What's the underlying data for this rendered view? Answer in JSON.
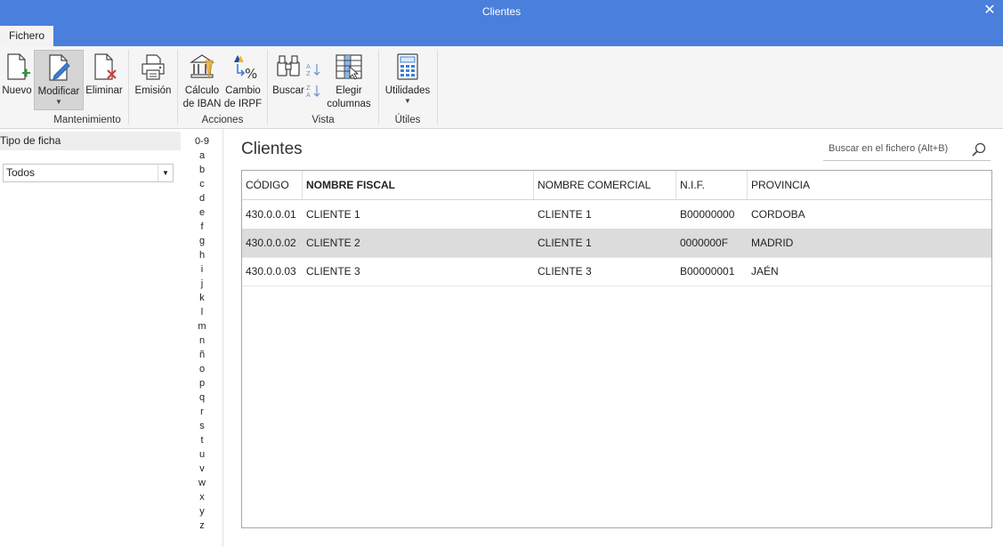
{
  "window": {
    "title": "Clientes",
    "close_label": "✕"
  },
  "tabs": [
    {
      "label": "Fichero"
    }
  ],
  "ribbon": {
    "buttons": [
      {
        "label1": "Nuevo",
        "label2": ""
      },
      {
        "label1": "Modificar",
        "label2": ""
      },
      {
        "label1": "Eliminar",
        "label2": ""
      },
      {
        "label1": "Emisión",
        "label2": ""
      },
      {
        "label1": "Cálculo",
        "label2": "de IBAN"
      },
      {
        "label1": "Cambio",
        "label2": "de IRPF"
      },
      {
        "label1": "Buscar",
        "label2": ""
      },
      {
        "label1": "Elegir",
        "label2": "columnas"
      },
      {
        "label1": "Utilidades",
        "label2": ""
      }
    ],
    "groups": [
      {
        "label": "Mantenimiento"
      },
      {
        "label": "Acciones"
      },
      {
        "label": "Vista"
      },
      {
        "label": "Útiles"
      }
    ]
  },
  "sidebar": {
    "heading": "Tipo de ficha",
    "select_value": "Todos"
  },
  "alphabet": [
    "0-9",
    "a",
    "b",
    "c",
    "d",
    "e",
    "f",
    "g",
    "h",
    "i",
    "j",
    "k",
    "l",
    "m",
    "n",
    "ñ",
    "o",
    "p",
    "q",
    "r",
    "s",
    "t",
    "u",
    "v",
    "w",
    "x",
    "y",
    "z"
  ],
  "main": {
    "title": "Clientes",
    "search_placeholder": "Buscar en el fichero (Alt+B)"
  },
  "table": {
    "columns": [
      "CÓDIGO",
      "NOMBRE FISCAL",
      "NOMBRE COMERCIAL",
      "N.I.F.",
      "PROVINCIA"
    ],
    "rows": [
      [
        "430.0.0.01",
        "CLIENTE 1",
        "CLIENTE 1",
        "B00000000",
        "CORDOBA"
      ],
      [
        "430.0.0.02",
        "CLIENTE 2",
        "CLIENTE 1",
        "0000000F",
        "MADRID"
      ],
      [
        "430.0.0.03",
        "CLIENTE 3",
        "CLIENTE 3",
        "B00000001",
        "JAÉN"
      ]
    ],
    "selected_row": 1
  },
  "colors": {
    "title_bar": "#4a7fdc",
    "selected_row": "#dcdcdc"
  }
}
